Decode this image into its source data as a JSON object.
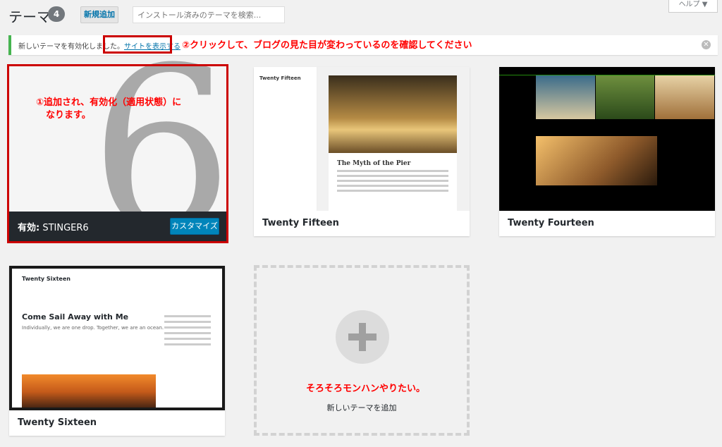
{
  "header": {
    "title": "テーマ",
    "count": "4",
    "add_new": "新規追加",
    "search_placeholder": "インストール済みのテーマを検索...",
    "help": "ヘルプ ▼"
  },
  "notice": {
    "text": "新しいテーマを有効化しました。",
    "link": "サイトを表示する"
  },
  "annotations": {
    "a1": "①追加され、有効化（適用状態）に",
    "a1b": "なります。",
    "a2": "②クリックして、ブログの見た目が変わっているのを確認してください",
    "a3": "そろそろモンハンやりたい。"
  },
  "themes": {
    "active": {
      "label_prefix": "有効:",
      "name": "STINGER6",
      "customize": "カスタマイズ"
    },
    "t15": {
      "name": "Twenty Fifteen",
      "post_title": "The Myth of the Pier",
      "site_title": "Twenty Fifteen"
    },
    "t14": {
      "name": "Twenty Fourteen"
    },
    "t16": {
      "name": "Twenty Sixteen",
      "site_title": "Twenty Sixteen",
      "post_title": "Come Sail Away with Me",
      "post_sub": "Individually, we are one drop. Together, we are an ocean."
    }
  },
  "add_new_theme": "新しいテーマを追加"
}
